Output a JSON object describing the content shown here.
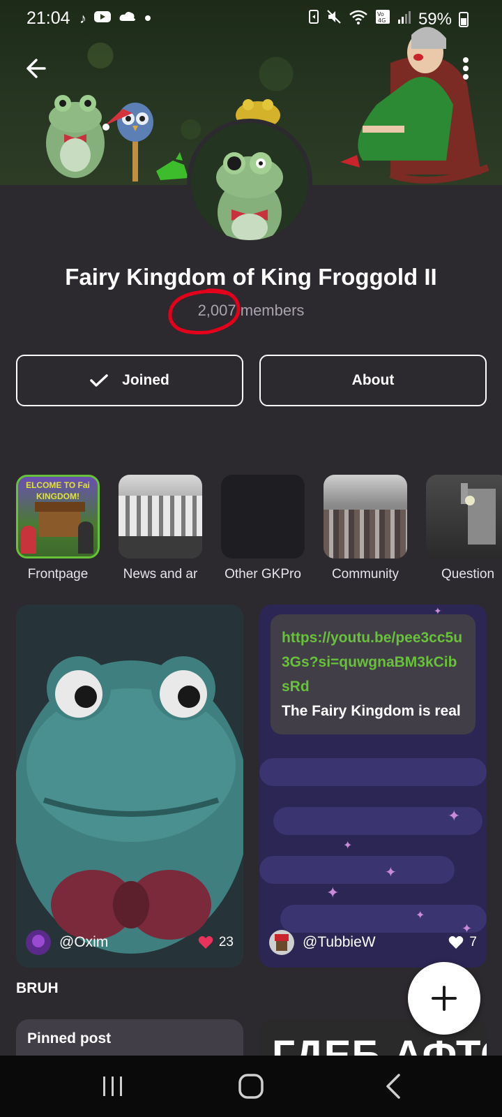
{
  "status_bar": {
    "time": "21:04",
    "battery": "59%",
    "left_icons": [
      "tiktok-icon",
      "youtube-icon",
      "cloud-icon",
      "dot-icon"
    ],
    "right_icons": [
      "battery-saver-icon",
      "mute-icon",
      "wifi-icon",
      "volte-4g-icon",
      "signal-icon",
      "battery-icon"
    ]
  },
  "community": {
    "title": "Fairy Kingdom of King Froggold II",
    "members_count": "2,007",
    "members_label": "members"
  },
  "actions": {
    "joined_label": "Joined",
    "about_label": "About"
  },
  "categories": [
    {
      "label": "Frontpage"
    },
    {
      "label": "News and ar"
    },
    {
      "label": "Other GKPro"
    },
    {
      "label": "Community"
    },
    {
      "label": "Question"
    }
  ],
  "frontpage_thumb_text": "ELCOME TO Fai KINGDOM!",
  "posts": [
    {
      "user": "@Oxim",
      "likes": "23"
    },
    {
      "user": "@TubbieW",
      "likes": "7",
      "link": "https://youtu.be/pee3cc5u3Gs?si=quwgnaBM3kCibsRd",
      "text": "The Fairy Kingdom is real"
    }
  ],
  "caption": "BRUH",
  "pinned_label": "Pinned post",
  "partial_card_text": "ГДЕБ АФТО!",
  "colors": {
    "background": "#2c292f",
    "accent_green": "#67c23a",
    "like_red": "#e8335a",
    "annotation_red": "#e4001b"
  }
}
